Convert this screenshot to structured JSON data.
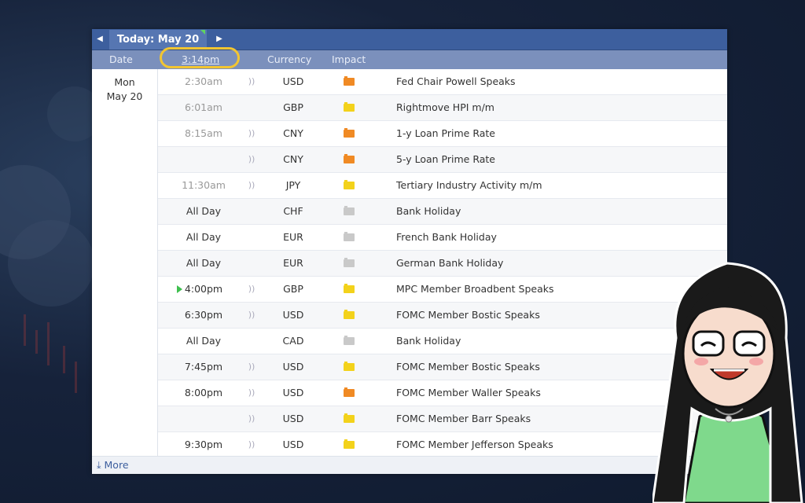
{
  "nav": {
    "prev_label": "◀",
    "today_label": "Today: May 20",
    "next_label": "▶"
  },
  "headers": {
    "date": "Date",
    "time": "3:14pm",
    "currency": "Currency",
    "impact": "Impact"
  },
  "date_cell": {
    "weekday": "Mon",
    "day": "May 20"
  },
  "rows": [
    {
      "time": "2:30am",
      "speaker": true,
      "currency": "USD",
      "impact": "orange",
      "event": "Fed Chair Powell Speaks",
      "past": true
    },
    {
      "time": "6:01am",
      "speaker": false,
      "currency": "GBP",
      "impact": "yellow",
      "event": "Rightmove HPI m/m",
      "past": true
    },
    {
      "time": "8:15am",
      "speaker": true,
      "currency": "CNY",
      "impact": "orange",
      "event": "1-y Loan Prime Rate",
      "past": true
    },
    {
      "time": "",
      "speaker": true,
      "currency": "CNY",
      "impact": "orange",
      "event": "5-y Loan Prime Rate",
      "past": true
    },
    {
      "time": "11:30am",
      "speaker": true,
      "currency": "JPY",
      "impact": "yellow",
      "event": "Tertiary Industry Activity m/m",
      "past": true
    },
    {
      "time": "All Day",
      "speaker": false,
      "currency": "CHF",
      "impact": "gray",
      "event": "Bank Holiday",
      "past": false
    },
    {
      "time": "All Day",
      "speaker": false,
      "currency": "EUR",
      "impact": "gray",
      "event": "French Bank Holiday",
      "past": false
    },
    {
      "time": "All Day",
      "speaker": false,
      "currency": "EUR",
      "impact": "gray",
      "event": "German Bank Holiday",
      "past": false
    },
    {
      "time": "4:00pm",
      "speaker": true,
      "currency": "GBP",
      "impact": "yellow",
      "event": "MPC Member Broadbent Speaks",
      "past": false,
      "next": true
    },
    {
      "time": "6:30pm",
      "speaker": true,
      "currency": "USD",
      "impact": "yellow",
      "event": "FOMC Member Bostic Speaks",
      "past": false
    },
    {
      "time": "All Day",
      "speaker": false,
      "currency": "CAD",
      "impact": "gray",
      "event": "Bank Holiday",
      "past": false
    },
    {
      "time": "7:45pm",
      "speaker": true,
      "currency": "USD",
      "impact": "yellow",
      "event": "FOMC Member Bostic Speaks",
      "past": false
    },
    {
      "time": "8:00pm",
      "speaker": true,
      "currency": "USD",
      "impact": "orange",
      "event": "FOMC Member Waller Speaks",
      "past": false
    },
    {
      "time": "",
      "speaker": true,
      "currency": "USD",
      "impact": "yellow",
      "event": "FOMC Member Barr Speaks",
      "past": false
    },
    {
      "time": "9:30pm",
      "speaker": true,
      "currency": "USD",
      "impact": "yellow",
      "event": "FOMC Member Jefferson Speaks",
      "past": false
    }
  ],
  "footer": {
    "more_label": "More",
    "more_icon": "download-arrow-icon"
  },
  "colors": {
    "nav_bg": "#3d5f9e",
    "header_bg": "#7b90bc",
    "highlight_ring": "#f2c531",
    "impact_orange": "#f08a24",
    "impact_yellow": "#f3d21b",
    "impact_gray": "#c9c9c9"
  }
}
